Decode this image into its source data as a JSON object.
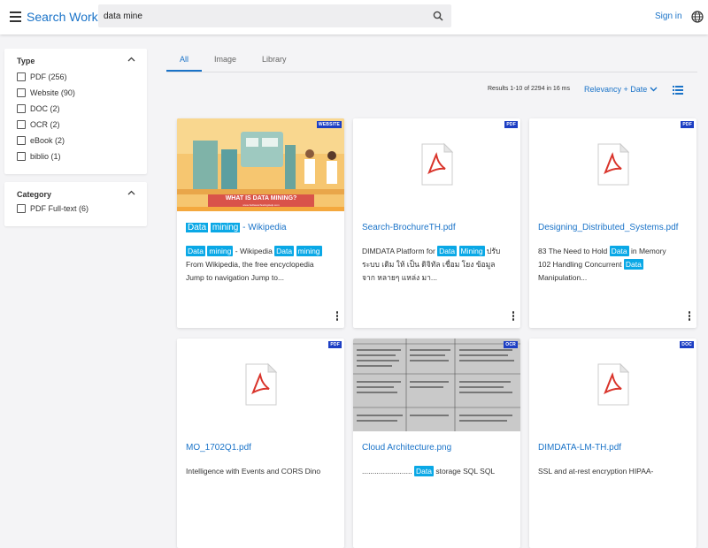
{
  "header": {
    "brand": "Search Work",
    "search_value": "data mine",
    "signin_label": "Sign in"
  },
  "facets": [
    {
      "title": "Type",
      "options": [
        "PDF (256)",
        "Website (90)",
        "DOC (2)",
        "OCR (2)",
        "eBook (2)",
        "biblio (1)"
      ]
    },
    {
      "title": "Category",
      "options": [
        "PDF Full-text (6)"
      ]
    }
  ],
  "tabs": [
    "All",
    "Image",
    "Library"
  ],
  "results": {
    "count_text": "Results 1-10 of 2294 in 16 ms",
    "sort_label": "Relevancy + Date"
  },
  "cards": [
    {
      "badge": "WEBSITE",
      "thumb_title": "WHAT IS DATA MINING?",
      "thumb_sub": "www.SoftwareTestingHelp.com",
      "title": [
        "Data",
        "mining",
        " - Wikipedia"
      ],
      "title_hl": [
        true,
        true,
        false
      ],
      "snippet": [
        [
          "Data",
          "mining",
          " - Wikipedia ",
          "Data",
          "mining"
        ],
        [
          "From Wikipedia, the free encyclopedia"
        ],
        [
          "Jump to navigation Jump to..."
        ]
      ],
      "snippet_hl": [
        [
          true,
          true,
          false,
          true,
          true
        ],
        [
          false
        ],
        [
          false
        ]
      ]
    },
    {
      "badge": "PDF",
      "title": [
        "Search-BrochureTH.pdf"
      ],
      "title_hl": [
        false
      ],
      "snippet": [
        [
          "DIMDATA Platform for ",
          "Data",
          " ",
          "Mining",
          " ปรับ"
        ],
        [
          "ระบบ เดิม ให้ เป็น ดิจิทัล เชื่อม โยง ข้อมูล"
        ],
        [
          "จาก หลายๆ แหล่ง มา..."
        ]
      ],
      "snippet_hl": [
        [
          false,
          true,
          false,
          true,
          false
        ],
        [
          false
        ],
        [
          false
        ]
      ]
    },
    {
      "badge": "PDF",
      "title": [
        "Designing_Distributed_Systems.pdf"
      ],
      "title_hl": [
        false
      ],
      "snippet": [
        [
          "83 The Need to Hold ",
          "Data",
          " in Memory"
        ],
        [
          "102 Handling Concurrent ",
          "Data"
        ],
        [
          "Manipulation..."
        ]
      ],
      "snippet_hl": [
        [
          false,
          true,
          false
        ],
        [
          false,
          true
        ],
        [
          false
        ]
      ]
    },
    {
      "badge": "PDF",
      "title": [
        "MO_1702Q1.pdf"
      ],
      "title_hl": [
        false
      ],
      "snippet": [
        [
          "Intelligence with Events and CORS Dino"
        ]
      ],
      "snippet_hl": [
        [
          false
        ]
      ]
    },
    {
      "badge": "OCR",
      "title": [
        "Cloud Architecture.png"
      ],
      "title_hl": [
        false
      ],
      "snippet": [
        [
          "........................ ",
          "Data",
          " storage SQL SQL"
        ]
      ],
      "snippet_hl": [
        [
          false,
          true,
          false
        ]
      ]
    },
    {
      "badge": "DOC",
      "title": [
        "DIMDATA-LM-TH.pdf"
      ],
      "title_hl": [
        false
      ],
      "snippet": [
        [
          "SSL and at-rest encryption HIPAA-"
        ]
      ],
      "snippet_hl": [
        [
          false
        ]
      ]
    }
  ],
  "colors": {
    "accent": "#1a73c8",
    "highlight": "#0aa8e6",
    "badge": "#1d3fc4",
    "pdf_red": "#d9342b"
  }
}
